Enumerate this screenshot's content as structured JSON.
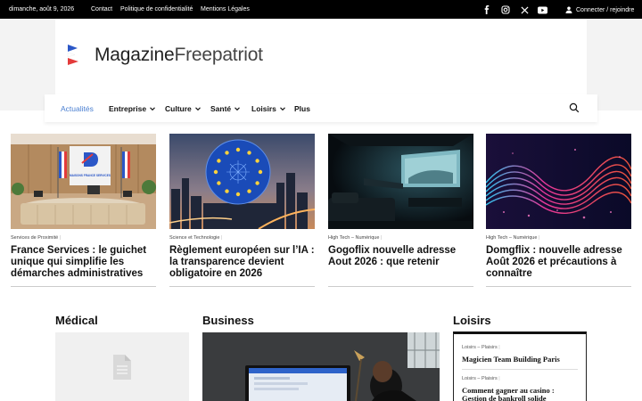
{
  "topbar": {
    "date": "dimanche, août 9, 2026",
    "links": [
      "Contact",
      "Politique de confidentialité",
      "Mentions Légales"
    ],
    "social_icons": [
      "facebook-icon",
      "instagram-icon",
      "x-icon",
      "youtube-icon"
    ],
    "login": "Connecter / rejoindre"
  },
  "logo": {
    "part1": "Magazine",
    "part2": "Freepatriot"
  },
  "nav": {
    "items": [
      {
        "label": "Actualités",
        "active": true
      },
      {
        "label": "Entreprise",
        "dropdown": true
      },
      {
        "label": "Culture",
        "dropdown": true
      },
      {
        "label": "Santé",
        "dropdown": true
      },
      {
        "label": "Loisirs",
        "dropdown": true
      },
      {
        "label": "Plus"
      }
    ],
    "accent": "#4a7fd1"
  },
  "articles": [
    {
      "category": "Services de Proximité",
      "title": "France Services : le guichet unique qui simplifie les démarches administratives",
      "sign": "MAISONS FRANCE SERVICES"
    },
    {
      "category": "Science et Technologie",
      "title": "Règlement européen sur l’IA : la transparence devient obligatoire en 2026"
    },
    {
      "category": "High Tech – Numérique",
      "title": "Gogoflix nouvelle adresse Aout 2026 : que retenir"
    },
    {
      "category": "High Tech – Numérique",
      "title": "Domgflix : nouvelle adresse Août 2026 et précautions à connaître"
    }
  ],
  "sections": {
    "medical": "Médical",
    "business": "Business",
    "loisirs": {
      "title": "Loisirs",
      "items": [
        {
          "category": "Loisirs – Plaisirs",
          "title": "Magicien Team Building Paris"
        },
        {
          "category": "Loisirs – Plaisirs",
          "title": "Comment gagner au casino : Gestion de bankroll solide"
        }
      ]
    }
  }
}
